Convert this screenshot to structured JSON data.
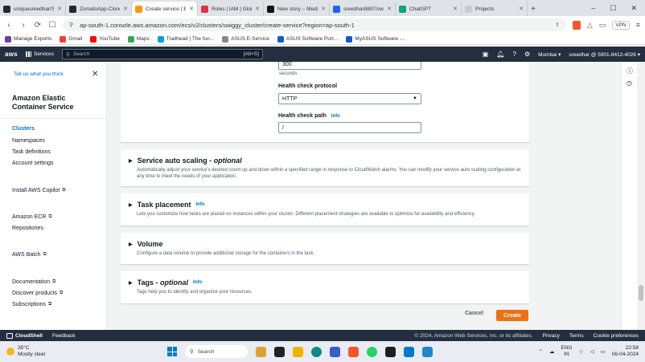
{
  "browser": {
    "tabs": [
      {
        "title": "uniquesreedhar/Swi",
        "color": "#24292f"
      },
      {
        "title": "ZomatoApp-Clone/G",
        "color": "#24292f"
      },
      {
        "title": "Create service | E",
        "color": "#ff9900",
        "active": true
      },
      {
        "title": "Roles | IAM | Global",
        "color": "#dd344c"
      },
      {
        "title": "New story – Medium",
        "color": "#111111"
      },
      {
        "title": "sreedhar8897/swigg",
        "color": "#1d63ed"
      },
      {
        "title": "ChatGPT",
        "color": "#10a37f"
      },
      {
        "title": "Projects",
        "color": "#c8ccd1"
      }
    ],
    "url": "ap-south-1.console.aws.amazon.com/ecs/v2/clusters/swiggy_cluster/create-service?region=ap-south-1",
    "vpn_label": "VPN",
    "bookmarks": [
      {
        "label": "Manage Exports",
        "color": "#6b3fa0"
      },
      {
        "label": "Gmail",
        "color": "#ea4335"
      },
      {
        "label": "YouTube",
        "color": "#ff0000"
      },
      {
        "label": "Maps",
        "color": "#34a853"
      },
      {
        "label": "Trailhead | The fun...",
        "color": "#00a1e0"
      },
      {
        "label": "ASUS E-Service",
        "color": "#888888"
      },
      {
        "label": "ASUS Software Port...",
        "color": "#0a5ebd"
      },
      {
        "label": "MyASUS Software -...",
        "color": "#0a5ebd"
      }
    ]
  },
  "aws_header": {
    "logo": "aws",
    "services_label": "Services",
    "search_placeholder": "Search",
    "search_shortcut": "[Alt+S]",
    "region": "Mumbai",
    "account": "sreedhar @ 5901-8412-4026"
  },
  "sidebar": {
    "tell_us": "Tell us what you think",
    "service_title": "Amazon Elastic Container Service",
    "links": {
      "clusters": "Clusters",
      "namespaces": "Namespaces",
      "task_definitions": "Task definitions",
      "account_settings": "Account settings",
      "install_copilot": "Install AWS Copilot",
      "ecr": "Amazon ECR",
      "repositories": "Repositories",
      "batch": "AWS Batch",
      "documentation": "Documentation",
      "discover_products": "Discover products",
      "subscriptions": "Subscriptions"
    }
  },
  "form": {
    "timeout_value": "300",
    "timeout_unit": "seconds",
    "protocol_label": "Health check protocol",
    "protocol_value": "HTTP",
    "path_label": "Health check path",
    "path_info": "Info",
    "path_value": "/"
  },
  "sections": {
    "auto_scaling": {
      "title": "Service auto scaling -",
      "optional": "optional",
      "desc": "Automatically adjust your service's desired count up and down within a specified range in response to CloudWatch alarms. You can modify your service auto scaling configuration at any time to meet the needs of your application."
    },
    "task_placement": {
      "title": "Task placement",
      "info": "Info",
      "desc": "Lets you customize how tasks are placed on instances within your cluster. Different placement strategies are available to optimize for availability and efficiency."
    },
    "volume": {
      "title": "Volume",
      "desc": "Configure a data volume to provide additional storage for the containers in the task."
    },
    "tags": {
      "title": "Tags -",
      "optional": "optional",
      "info": "Info",
      "desc": "Tags help you to identify and organize your resources."
    }
  },
  "actions": {
    "cancel": "Cancel",
    "create": "Create"
  },
  "footer": {
    "cloudshell": "CloudShell",
    "feedback": "Feedback",
    "copyright": "© 2024, Amazon Web Services, Inc. or its affiliates.",
    "privacy": "Privacy",
    "terms": "Terms",
    "cookies": "Cookie preferences"
  },
  "taskbar": {
    "temp": "35°C",
    "weather": "Mostly clear",
    "search": "Search",
    "lang_line1": "ENG",
    "lang_line2": "IN",
    "time": "22:58",
    "date": "06-04-2024"
  }
}
